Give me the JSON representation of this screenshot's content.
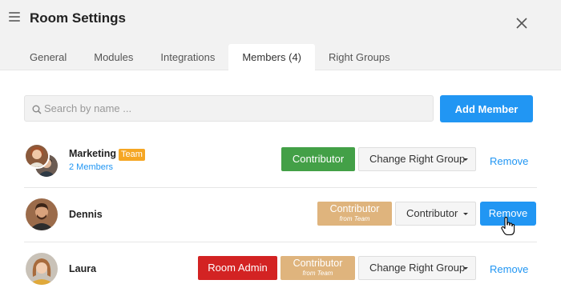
{
  "header": {
    "title": "Room Settings",
    "tabs": [
      {
        "label": "General"
      },
      {
        "label": "Modules"
      },
      {
        "label": "Integrations"
      },
      {
        "label": "Members (4)"
      },
      {
        "label": "Right Groups"
      }
    ],
    "active_tab": "Members (4)"
  },
  "toolbar": {
    "search_placeholder": "Search by name ...",
    "add_member_label": "Add Member"
  },
  "members": [
    {
      "name": "Marketing",
      "team_badge": "Team",
      "sub_label": "2 Members",
      "role": "Contributor",
      "change_label": "Change Right Group",
      "remove_label": "Remove"
    },
    {
      "name": "Dennis",
      "team_role": "Contributor",
      "team_role_note": "from Team",
      "dropdown_value": "Contributor",
      "remove_label": "Remove"
    },
    {
      "name": "Laura",
      "role": "Room Admin",
      "team_role": "Contributor",
      "team_role_note": "from Team",
      "change_label": "Change Right Group",
      "remove_label": "Remove"
    }
  ],
  "colors": {
    "accent": "#2196f3",
    "contributor": "#43a047",
    "room_admin": "#d32323",
    "team_role": "#dfb47d",
    "team_badge": "#f5a623"
  }
}
